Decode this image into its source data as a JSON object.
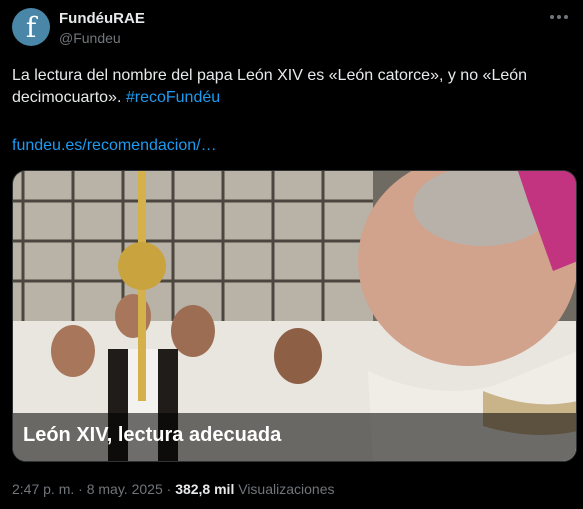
{
  "author": {
    "name": "FundéuRAE",
    "handle": "@Fundeu",
    "avatar_glyph": "f",
    "avatar_color": "#4a86a8"
  },
  "tweet": {
    "text_part1": "La lectura del nombre del papa León XIV es «León catorce», y no «León decimocuarto».",
    "hashtag": "#recoFundéu",
    "link": "fundeu.es/recomendacion/…"
  },
  "card": {
    "caption": "León XIV, lectura adecuada"
  },
  "meta": {
    "time": "2:47 p. m.",
    "separator1": " · ",
    "date": "8 may. 2025",
    "separator2": " · ",
    "views_count": "382,8 mil",
    "views_label": "Visualizaciones"
  },
  "colors": {
    "background": "#000000",
    "text": "#e7e9ea",
    "muted": "#71767b",
    "link": "#1d9bf0"
  },
  "icons": {
    "more": "more-horizontal-icon"
  }
}
